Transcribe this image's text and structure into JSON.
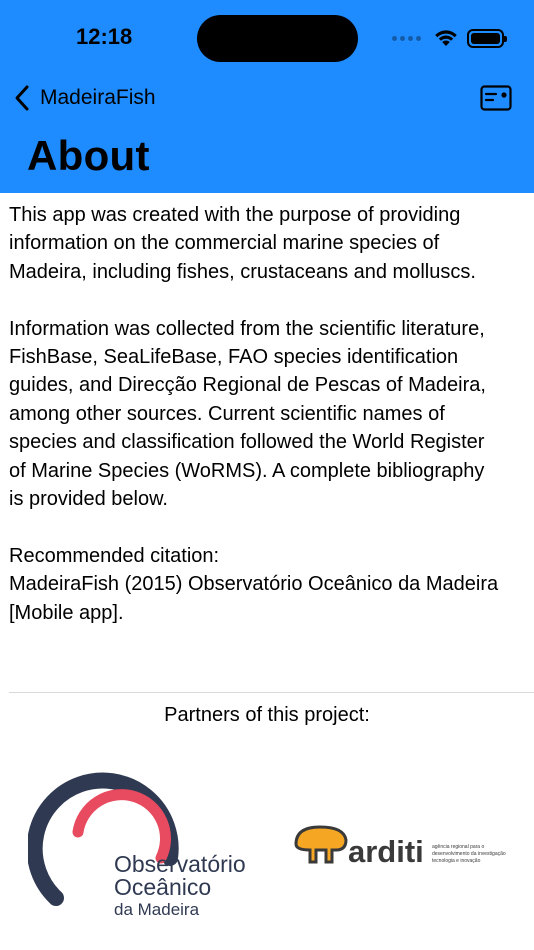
{
  "status_bar": {
    "time": "12:18"
  },
  "nav": {
    "back_label": "MadeiraFish",
    "title": "About"
  },
  "content": {
    "paragraph1_lines": [
      "This app was created with the purpose of providing",
      "information on the commercial marine species of",
      "Madeira, including fishes, crustaceans and molluscs."
    ],
    "paragraph2_lines": [
      "Information was collected from the scientific literature,",
      "FishBase, SeaLifeBase, FAO species identification",
      "guides, and Direcção Regional de Pescas of Madeira,",
      "among other sources. Current scientific names of",
      "species and classification followed the World Register",
      "of Marine Species (WoRMS). A complete bibliography",
      "is provided below."
    ],
    "citation_lines": [
      "Recommended citation:",
      "MadeiraFish (2015) Observatório Oceânico da Madeira",
      "[Mobile app]."
    ]
  },
  "partners": {
    "title": "Partners of this project:",
    "oom_logo": {
      "line1": "Observatório",
      "line2": "Oceânico",
      "line3": "da Madeira"
    },
    "arditi_logo": {
      "word": "arditi",
      "tagline_lines": [
        "agência regional para o",
        "desenvolvimento da investigação",
        "tecnologia e inovação"
      ]
    }
  },
  "colors": {
    "header_bg": "#1e8cff",
    "oom_dark": "#2f3a52",
    "oom_red": "#e84a5f",
    "arditi_orange": "#f5a623"
  },
  "icons": {
    "back": "chevron-left-icon",
    "card": "card-icon",
    "wifi": "wifi-icon",
    "battery": "battery-icon"
  }
}
